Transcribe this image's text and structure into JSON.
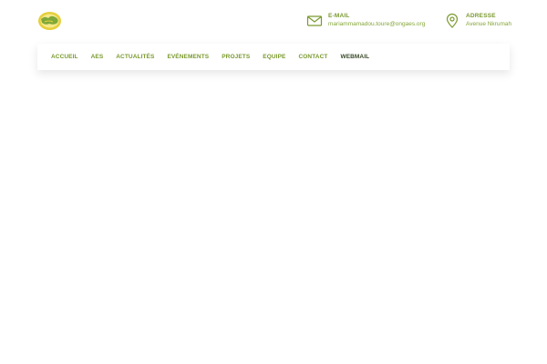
{
  "header": {
    "logo_icon": "organization-logo",
    "email": {
      "label": "E-MAIL",
      "value": "mariammamadou.toure@ongaes.org",
      "icon": "envelope-icon"
    },
    "address": {
      "label": "ADRESSE",
      "value": "Avenue Nkrumah",
      "icon": "map-pin-icon"
    }
  },
  "nav": {
    "items": [
      {
        "label": "ACCUEIL"
      },
      {
        "label": "AES"
      },
      {
        "label": "ACTUALITÉS"
      },
      {
        "label": "EVÉNEMENTS"
      },
      {
        "label": "PROJETS"
      },
      {
        "label": "EQUIPE"
      },
      {
        "label": "CONTACT"
      },
      {
        "label": "WEBMAIL"
      }
    ]
  },
  "colors": {
    "accent": "#7a9a2e",
    "logo_yellow": "#e6cf3a",
    "logo_green": "#7fa83a"
  }
}
